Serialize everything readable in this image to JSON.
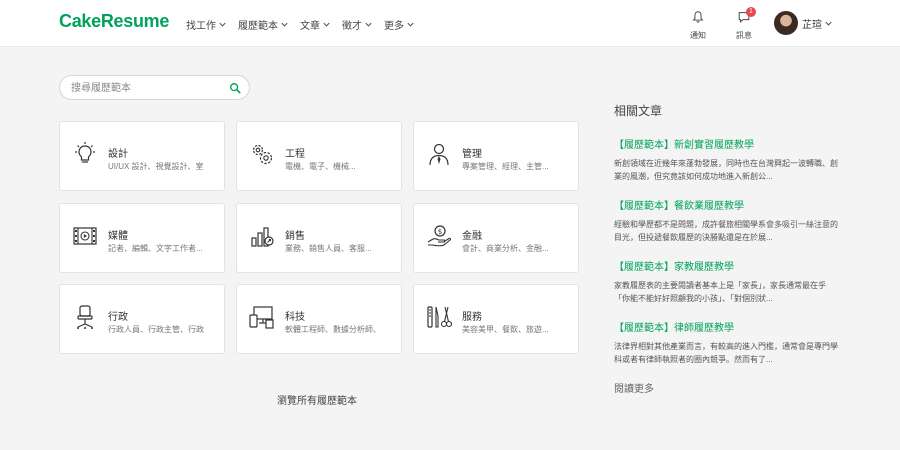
{
  "brand": {
    "name": "CakeResume",
    "color": "#00a35c"
  },
  "nav": [
    {
      "label": "找工作"
    },
    {
      "label": "履歷範本"
    },
    {
      "label": "文章"
    },
    {
      "label": "徵才"
    },
    {
      "label": "更多"
    }
  ],
  "header": {
    "notifications_label": "通知",
    "messages_label": "訊息",
    "messages_badge": "1",
    "user_name": "芷瑄"
  },
  "search": {
    "placeholder": "搜尋履歷範本",
    "value": ""
  },
  "categories": [
    {
      "title": "設計",
      "subtitle": "UI/UX 設計、視覺設計、室",
      "icon": "lightbulb-icon"
    },
    {
      "title": "工程",
      "subtitle": "電機、電子、機械...",
      "icon": "gears-icon"
    },
    {
      "title": "管理",
      "subtitle": "專案管理、經理、主管...",
      "icon": "manager-icon"
    },
    {
      "title": "媒體",
      "subtitle": "記者、編輯、文字工作者...",
      "icon": "film-icon"
    },
    {
      "title": "銷售",
      "subtitle": "業務、銷售人員、客服...",
      "icon": "chart-icon"
    },
    {
      "title": "金融",
      "subtitle": "會計、商業分析、金融...",
      "icon": "money-hand-icon"
    },
    {
      "title": "行政",
      "subtitle": "行政人員、行政主管、行政",
      "icon": "office-chair-icon"
    },
    {
      "title": "科技",
      "subtitle": "軟體工程師、數據分析師、",
      "icon": "devices-icon"
    },
    {
      "title": "服務",
      "subtitle": "美容美甲、餐飲、旅遊...",
      "icon": "tools-icon"
    }
  ],
  "browse_all": "瀏覽所有履歷範本",
  "sidebar": {
    "title": "相關文章",
    "articles": [
      {
        "title": "【履歷範本】新創實習履歷教學",
        "excerpt": "新創領域在近幾年來蓬勃發展，同時也在台灣興起一波轉職、創業的風潮，但究竟該如何成功地進入新創公..."
      },
      {
        "title": "【履歷範本】餐飲業履歷教學",
        "excerpt": "經驗和學歷都不是問題，成許餐旅相關學系會多吸引一絲注意的目光，但投遞餐飲履歷的決勝點還是在於展..."
      },
      {
        "title": "【履歷範本】家教履歷教學",
        "excerpt": "家教履歷表的主要閱讀者基本上是「家長」，家長通常最在乎「你能不能好好照顧我的小孩」、「對個別狀..."
      },
      {
        "title": "【履歷範本】律師履歷教學",
        "excerpt": "法律界相對其他產業而言，有較高的進入門檻，通常會是專門學科或者有律師執照者的圈內競爭。然而有了..."
      }
    ],
    "read_more": "閱讀更多"
  }
}
